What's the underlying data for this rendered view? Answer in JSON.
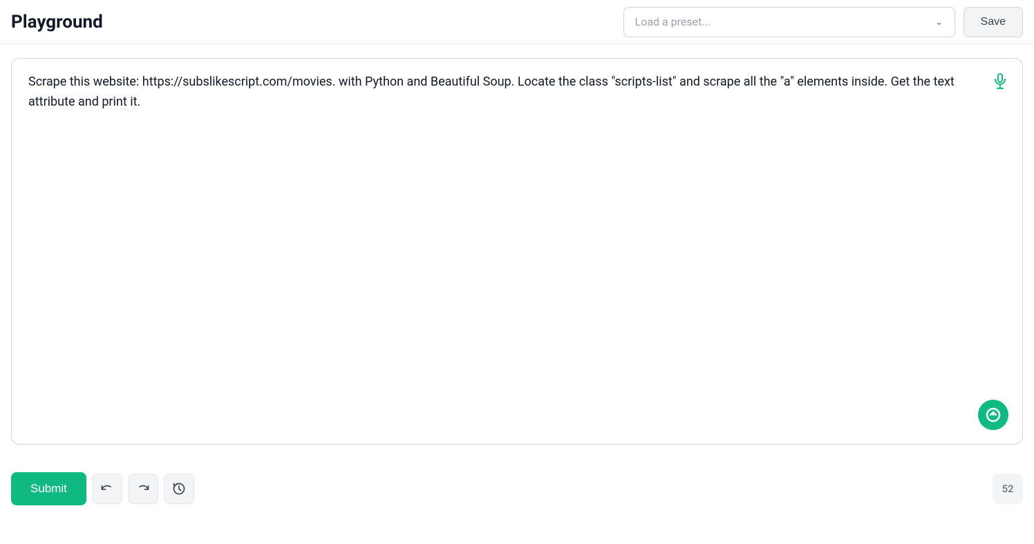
{
  "header": {
    "title": "Playground",
    "preset_placeholder": "Load a preset...",
    "save_label": "Save"
  },
  "main": {
    "prompt_text": "Scrape this website: https://subslikescript.com/movies. with Python and Beautiful Soup. Locate the class \"scripts-list\" and scrape all the \"a\" elements inside. Get the text attribute and print it."
  },
  "footer": {
    "submit_label": "Submit",
    "char_count": "52"
  }
}
